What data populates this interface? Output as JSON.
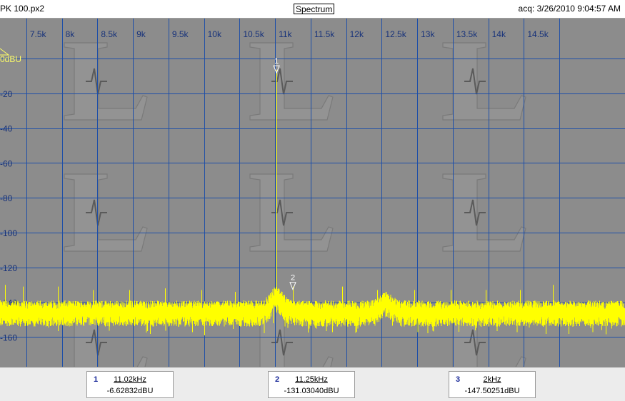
{
  "titlebar": {
    "file_name": "PK 100.px2",
    "view_button": "Spectrum",
    "acquisition": "acq: 3/26/2010 9:04:57 AM"
  },
  "chart_data": {
    "type": "line",
    "x_unit": "Hz",
    "y_unit": "dBU",
    "xlim": [
      7200,
      14970
    ],
    "ylim": [
      -168,
      12
    ],
    "x_ticks": [
      7500,
      8000,
      8500,
      9000,
      9500,
      10000,
      10500,
      11000,
      11500,
      12000,
      12500,
      13000,
      13500,
      14000,
      14500
    ],
    "x_tick_labels": [
      "7.5k",
      "8k",
      "8.5k",
      "9k",
      "9.5k",
      "10k",
      "10.5k",
      "11k",
      "11.5k",
      "12k",
      "12.5k",
      "13k",
      "13.5k",
      "14k",
      "14.5k"
    ],
    "y_ticks": [
      0,
      -20,
      -40,
      -60,
      -80,
      -100,
      -120,
      -140,
      -160
    ],
    "y_tick_labels": [
      "0dBU",
      "-20",
      "-40",
      "-60",
      "-80",
      "-100",
      "-120",
      "-140",
      "-160"
    ],
    "grid": true,
    "series": [
      {
        "noise_floor_db": -146,
        "peaks": [
          {
            "x": 7200,
            "y": -130
          },
          {
            "x": 7450,
            "y": -131
          },
          {
            "x": 7940,
            "y": -131
          },
          {
            "x": 8440,
            "y": -133
          },
          {
            "x": 8950,
            "y": -133
          },
          {
            "x": 9450,
            "y": -132
          },
          {
            "x": 9960,
            "y": -133
          },
          {
            "x": 10440,
            "y": -134
          },
          {
            "x": 11020,
            "y": -6.6
          },
          {
            "x": 11250,
            "y": -131
          },
          {
            "x": 11940,
            "y": -131
          },
          {
            "x": 12440,
            "y": -133
          },
          {
            "x": 12960,
            "y": -133
          },
          {
            "x": 13470,
            "y": -133
          },
          {
            "x": 13960,
            "y": -133
          },
          {
            "x": 14450,
            "y": -133
          },
          {
            "x": 14910,
            "y": -130
          }
        ],
        "bumps": [
          {
            "x": 11020,
            "height_db": 8
          },
          {
            "x": 12560,
            "height_db": 5
          }
        ]
      }
    ],
    "markers": [
      {
        "label": "1",
        "x": 11020,
        "y": -6.62832
      },
      {
        "label": "2",
        "x": 11250,
        "y": -131.0304
      }
    ]
  },
  "marker_readouts": [
    {
      "number": "1",
      "frequency": "11.02kHz",
      "level": "-6.62832dBU"
    },
    {
      "number": "2",
      "frequency": "11.25kHz",
      "level": "-131.03040dBU"
    },
    {
      "number": "3",
      "frequency": "2kHz",
      "level": "-147.50251dBU"
    }
  ],
  "colors": {
    "plot_background": "#8c8c8c",
    "grid": "#1e4fa8",
    "trace": "#ffff00",
    "tick_label": "#17327a",
    "zero_label": "#ffff66",
    "marker_number": "#1a2a9a"
  }
}
